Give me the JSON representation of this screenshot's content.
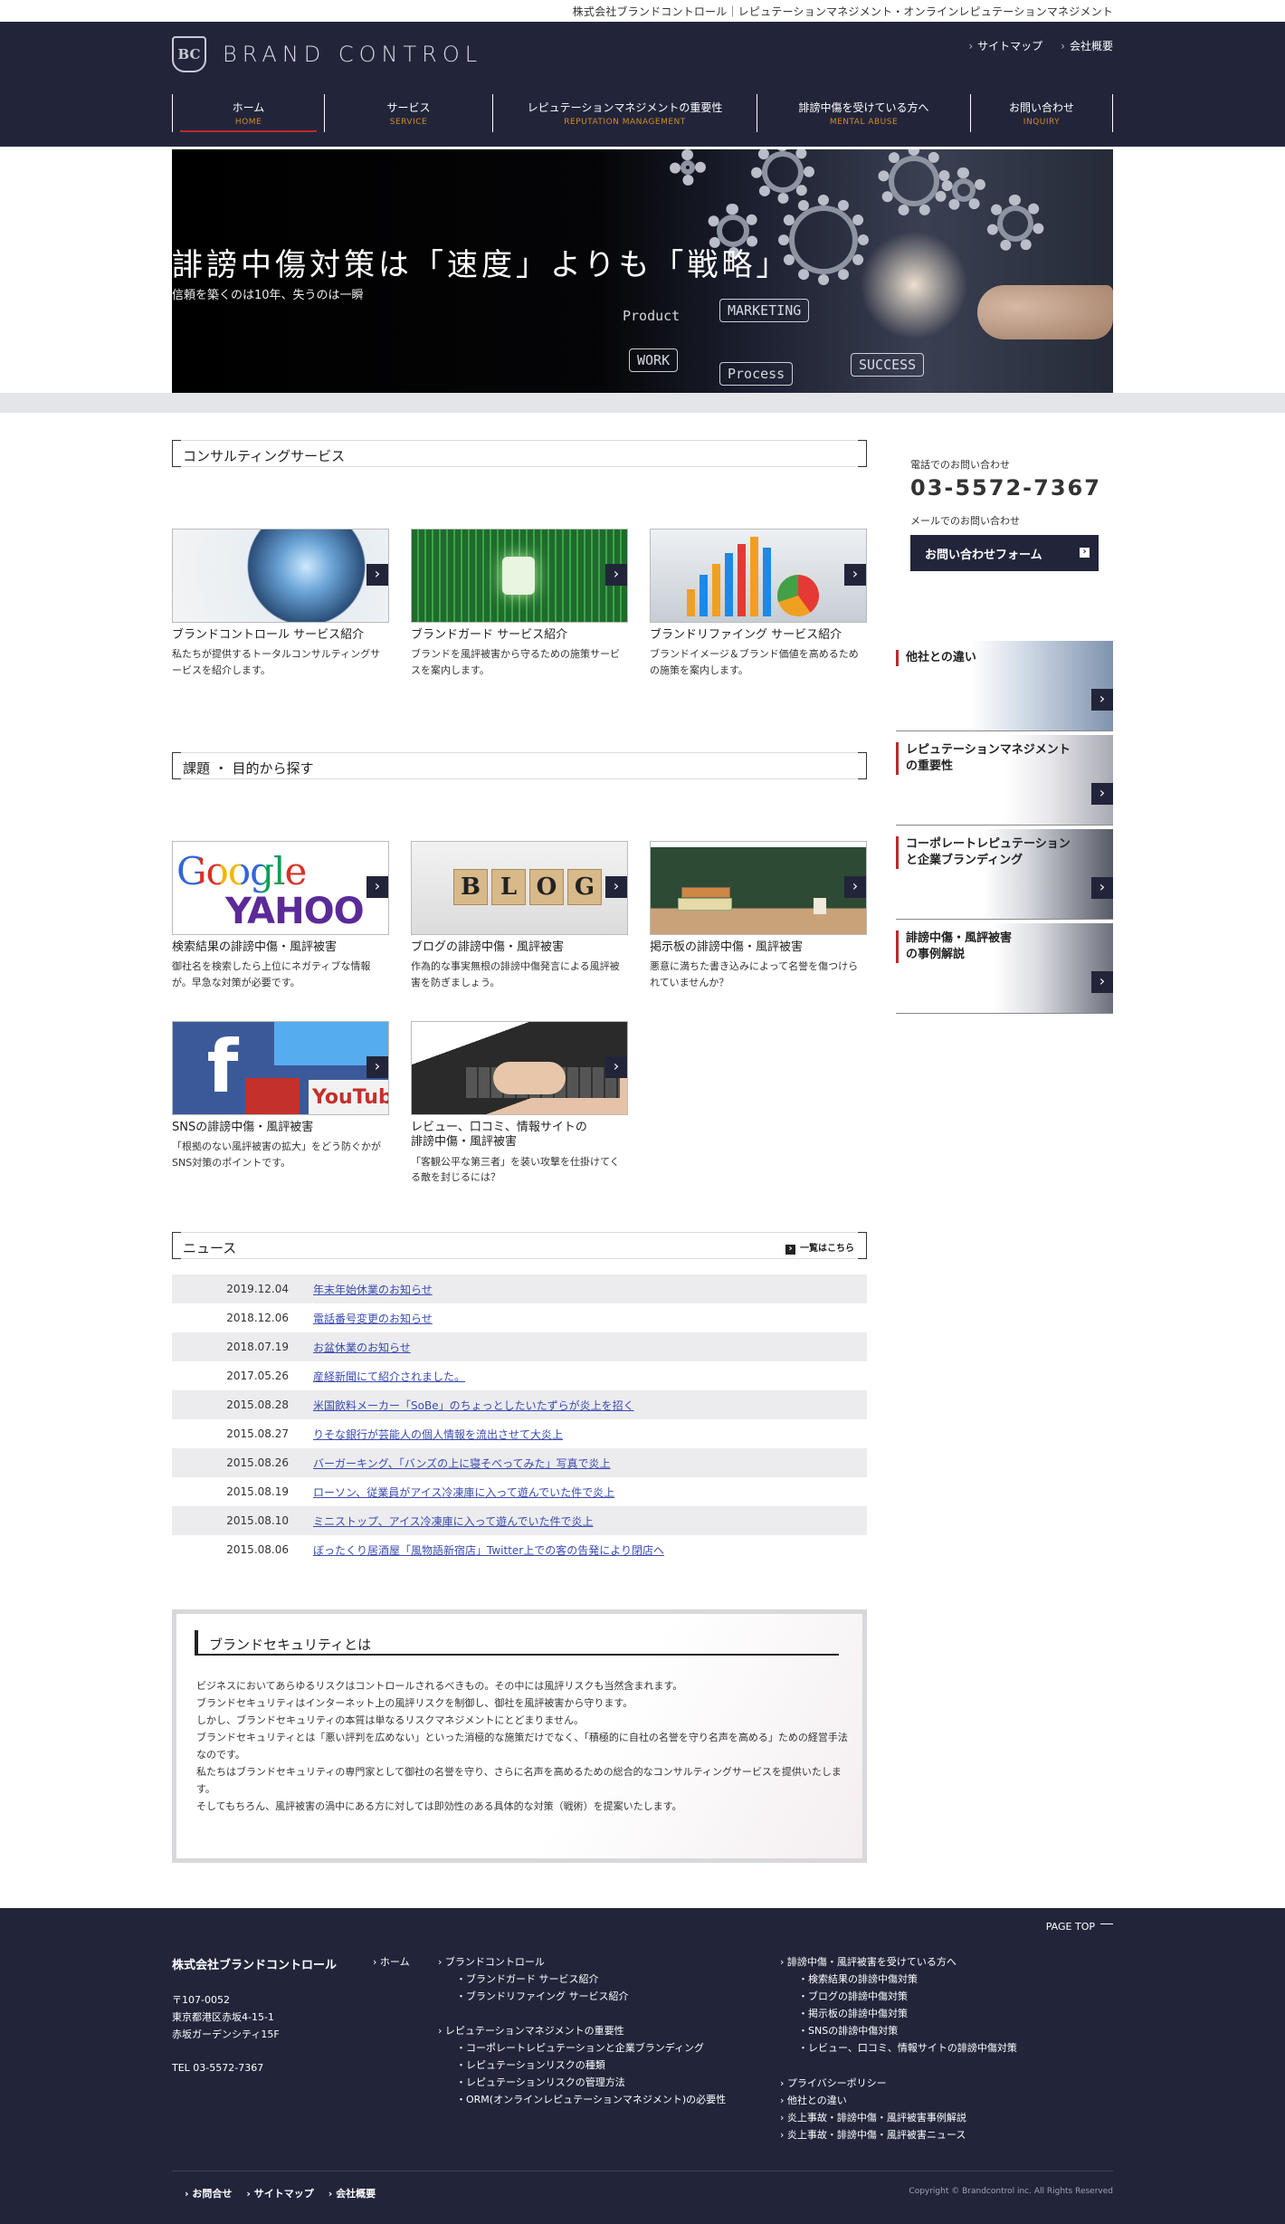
{
  "topbar": {
    "tagline": "株式会社ブランドコントロール｜レピュテーションマネジメント・オンラインレピュテーションマネジメント"
  },
  "header": {
    "logo_mark": "BC",
    "logo_text": "BRAND CONTROL",
    "util_links": [
      "サイトマップ",
      "会社概要"
    ],
    "nav": [
      {
        "jp": "ホーム",
        "en": "HOME"
      },
      {
        "jp": "サービス",
        "en": "SERVICE"
      },
      {
        "jp": "レピュテーションマネジメントの重要性",
        "en": "REPUTATION MANAGEMENT"
      },
      {
        "jp": "誹謗中傷を受けている方へ",
        "en": "MENTAL ABUSE"
      },
      {
        "jp": "お問い合わせ",
        "en": "INQUIRY"
      }
    ]
  },
  "hero": {
    "title": "誹謗中傷対策は「速度」よりも「戦略」",
    "subtitle": "信頼を築くのは10年、失うのは一瞬",
    "sketch_words": [
      "MARKETING",
      "Product",
      "WORK",
      "Process",
      "SUCCESS"
    ]
  },
  "consulting": {
    "heading": "コンサルティングサービス",
    "cards": [
      {
        "title": "ブランドコントロール サービス紹介",
        "desc": "私たちが提供するトータルコンサルティングサービスを紹介します。"
      },
      {
        "title": "ブランドガード サービス紹介",
        "desc": "ブランドを風評被害から守るための施策サービスを案内します。"
      },
      {
        "title": "ブランドリファイング サービス紹介",
        "desc": "ブランドイメージ＆ブランド価値を高めるための施策を案内します。"
      }
    ]
  },
  "issues": {
    "heading": "課題 ・ 目的から探す",
    "cards": [
      {
        "title": "検索結果の誹謗中傷・風評被害",
        "desc": "御社名を検索したら上位にネガティブな情報が。早急な対策が必要です。"
      },
      {
        "title": "ブログの誹謗中傷・風評被害",
        "desc": "作為的な事実無根の誹謗中傷発言による風評被害を防ぎましょう。"
      },
      {
        "title": "掲示板の誹謗中傷・風評被害",
        "desc": "悪意に満ちた書き込みによって名誉を傷つけられていませんか？"
      },
      {
        "title": "SNSの誹謗中傷・風評被害",
        "desc": "「根拠のない風評被害の拡大」をどう防ぐかがSNS対策のポイントです。"
      },
      {
        "title": "レビュー、口コミ、情報サイトの\n誹謗中傷・風評被害",
        "desc": "「客観公平な第三者」を装い攻撃を仕掛けてくる敵を封じるには？"
      }
    ],
    "thumb_words": {
      "google": "Google",
      "yahoo": "YAHOO",
      "blog": [
        "B",
        "L",
        "O",
        "G"
      ],
      "youtube": "YouTube"
    }
  },
  "news": {
    "heading": "ニュース",
    "more": "一覧はこちら",
    "items": [
      {
        "date": "2019.12.04",
        "title": "年末年始休業のお知らせ"
      },
      {
        "date": "2018.12.06",
        "title": "電話番号変更のお知らせ"
      },
      {
        "date": "2018.07.19",
        "title": "お盆休業のお知らせ"
      },
      {
        "date": "2017.05.26",
        "title": "産経新聞にて紹介されました。"
      },
      {
        "date": "2015.08.28",
        "title": "米国飲料メーカー「SoBe」のちょっとしたいたずらが炎上を招く"
      },
      {
        "date": "2015.08.27",
        "title": "りそな銀行が芸能人の個人情報を流出させて大炎上"
      },
      {
        "date": "2015.08.26",
        "title": "バーガーキング、「バンズの上に寝そべってみた」写真で炎上"
      },
      {
        "date": "2015.08.19",
        "title": "ローソン、従業員がアイス冷凍庫に入って遊んでいた件で炎上"
      },
      {
        "date": "2015.08.10",
        "title": "ミニストップ、アイス冷凍庫に入って遊んでいた件で炎上"
      },
      {
        "date": "2015.08.06",
        "title": "ぼったくり居酒屋「風物語新宿店」Twitter上での客の告発により閉店へ"
      }
    ]
  },
  "brand_security": {
    "heading": "ブランドセキュリティとは",
    "paragraphs": [
      "ビジネスにおいてあらゆるリスクはコントロールされるべきもの。その中には風評リスクも当然含まれます。",
      "ブランドセキュリティはインターネット上の風評リスクを制御し、御社を風評被害から守ります。",
      "しかし、ブランドセキュリティの本質は単なるリスクマネジメントにとどまりません。",
      "ブランドセキュリティとは「悪い評判を広めない」といった消極的な施策だけでなく、「積極的に自社の名誉を守り名声を高める」ための経営手法なのです。",
      "私たちはブランドセキュリティの専門家として御社の名誉を守り、さらに名声を高めるための総合的なコンサルティングサービスを提供いたします。",
      "そしてもちろん、風評被害の渦中にある方に対しては即効性のある具体的な対策（戦術）を提案いたします。"
    ]
  },
  "sidebar": {
    "tel_label": "電話でのお問い合わせ",
    "tel": "03-5572-7367",
    "mail_label": "メールでのお問い合わせ",
    "form_button": "お問い合わせフォーム",
    "banners": [
      {
        "label": "他社との違い"
      },
      {
        "label": "レピュテーションマネジメント\nの重要性"
      },
      {
        "label": "コーポレートレピュテーション\nと企業ブランディング"
      },
      {
        "label": "誹謗中傷・風評被害\nの事例解説"
      }
    ]
  },
  "footer": {
    "page_top": "PAGE TOP",
    "company": "株式会社ブランドコントロール",
    "address": [
      "〒107-0052",
      "東京都港区赤坂4-15-1",
      "赤坂ガーデンシティ15F"
    ],
    "tel": "TEL 03-5572-7367",
    "home": "ホーム",
    "col2_a": {
      "parent": "ブランドコントロール",
      "children": [
        "ブランドガード サービス紹介",
        "ブランドリファイング サービス紹介"
      ]
    },
    "col2_b": {
      "parent": "レピュテーションマネジメントの重要性",
      "children": [
        "コーポレートレピュテーションと企業ブランディング",
        "レピュテーションリスクの種類",
        "レピュテーションリスクの管理方法",
        "ORM(オンラインレピュテーションマネジメント)の必要性"
      ]
    },
    "col3_a": {
      "parent": "誹謗中傷・風評被害を受けている方へ",
      "children": [
        "検索結果の誹謗中傷対策",
        "ブログの誹謗中傷対策",
        "掲示板の誹謗中傷対策",
        "SNSの誹謗中傷対策",
        "レビュー、口コミ、情報サイトの誹謗中傷対策"
      ]
    },
    "col3_b": [
      "プライバシーポリシー",
      "他社との違い",
      "炎上事故・誹謗中傷・風評被害事例解説",
      "炎上事故・誹謗中傷・風評被害ニュース"
    ],
    "bottom_links": [
      "お問合せ",
      "サイトマップ",
      "会社概要"
    ],
    "copyright": "Copyright © Brandcontrol inc. All Rights Reserved"
  }
}
